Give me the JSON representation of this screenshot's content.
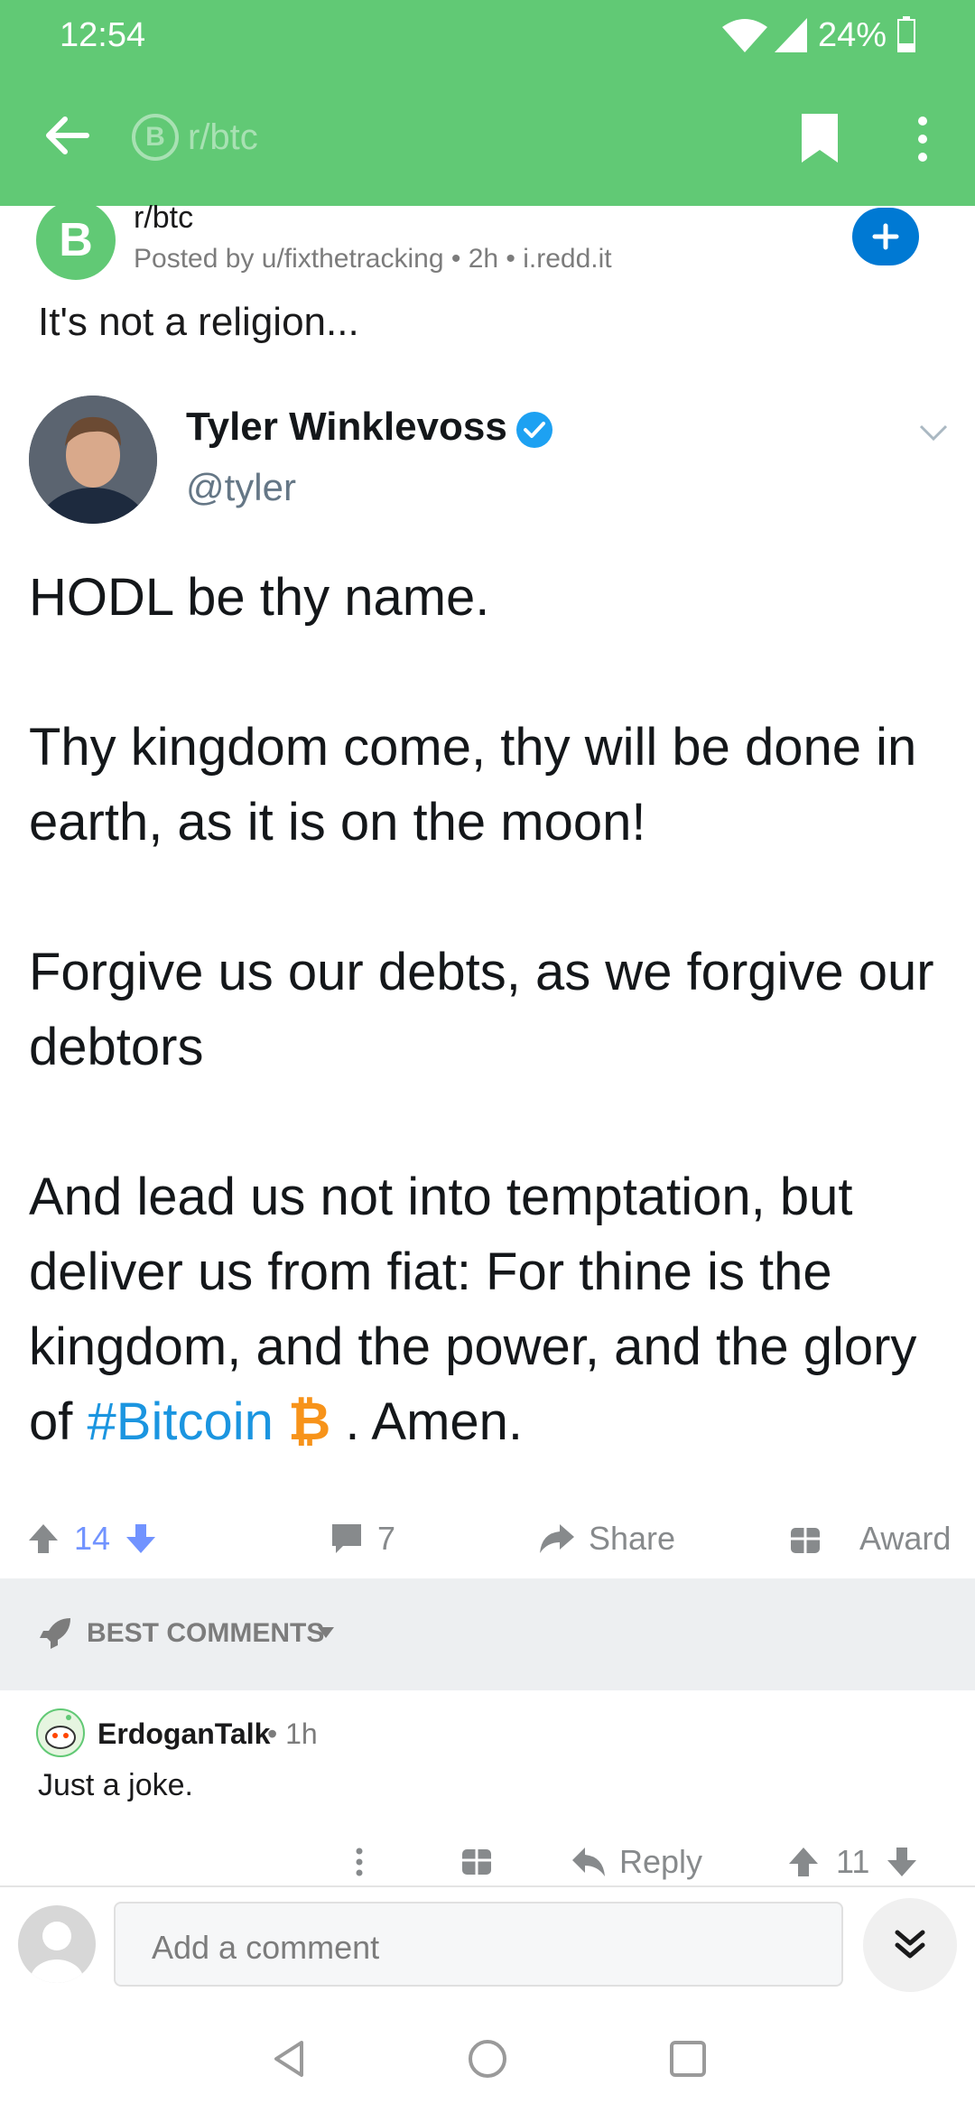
{
  "status_bar": {
    "time": "12:54",
    "battery": "24%"
  },
  "app_bar": {
    "subreddit": "r/btc",
    "coin_glyph": "B"
  },
  "post": {
    "subreddit": "r/btc",
    "avatar_glyph": "B",
    "meta": "Posted by u/fixthetracking • 2h • i.redd.it",
    "title": "It's not a religion..."
  },
  "tweet": {
    "name": "Tyler Winklevoss",
    "handle": "@tyler",
    "para1": "HODL be thy name.",
    "para2": "Thy kingdom come, thy will be done in earth, as it is on the moon!",
    "para3": "Forgive us our debts, as we forgive our debtors",
    "para4_prefix": "And lead us not into temptation, but deliver us from fiat: For thine is the kingdom, and the power, and the glory of ",
    "hashtag": "#Bitcoin",
    "emoji": "₿",
    "para4_suffix": " . Amen."
  },
  "actions": {
    "votes": "14",
    "comments": "7",
    "share": "Share",
    "award": "Award"
  },
  "sort": {
    "label": "BEST COMMENTS"
  },
  "comment": {
    "user": "ErdoganTalk",
    "time": "• 1h",
    "body": "Just a joke.",
    "reply": "Reply",
    "votes": "11"
  },
  "composer": {
    "placeholder": "Add a comment"
  }
}
